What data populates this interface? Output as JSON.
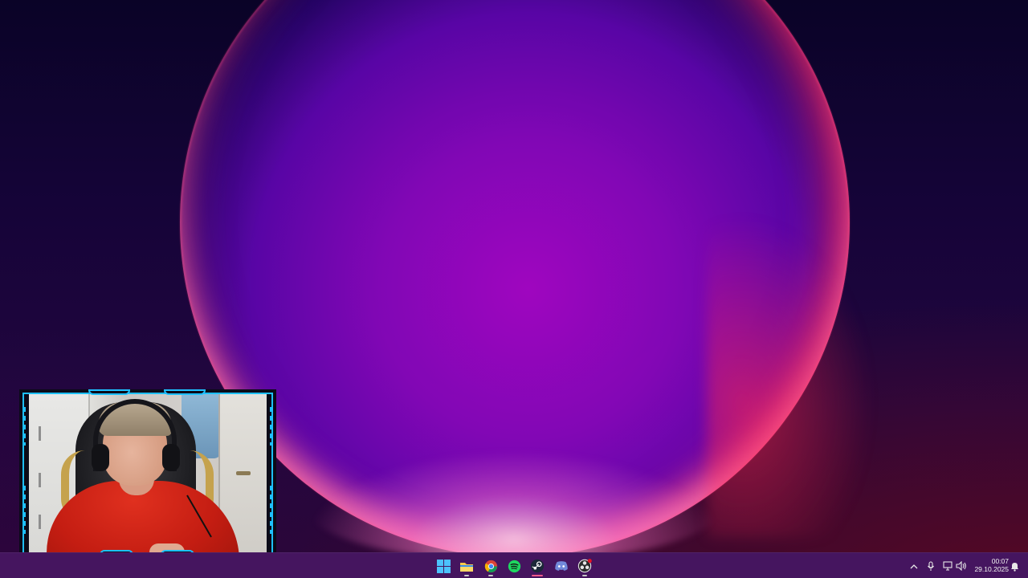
{
  "desktop": {
    "wallpaper": "purple-orb-wallpaper",
    "colors": {
      "taskbar": "#45155f",
      "frame_accent": "#1ec0ff",
      "active_indicator": "#f4598a"
    }
  },
  "webcam_overlay": {
    "description_icon": "webcam-feed"
  },
  "taskbar": {
    "apps": [
      {
        "name": "start",
        "icon": "windows-icon"
      },
      {
        "name": "file-explorer",
        "icon": "folder-icon"
      },
      {
        "name": "chrome",
        "icon": "chrome-icon"
      },
      {
        "name": "spotify",
        "icon": "spotify-icon"
      },
      {
        "name": "steam",
        "icon": "steam-icon",
        "active": true
      },
      {
        "name": "discord",
        "icon": "discord-icon"
      },
      {
        "name": "obs",
        "icon": "obs-icon"
      }
    ],
    "tray": {
      "icons": [
        "chevron-up-icon",
        "microphone-icon",
        "network-icon",
        "volume-icon",
        "notification-icon"
      ]
    },
    "clock": {
      "time": "00:07",
      "date": "29.10.2025"
    }
  }
}
